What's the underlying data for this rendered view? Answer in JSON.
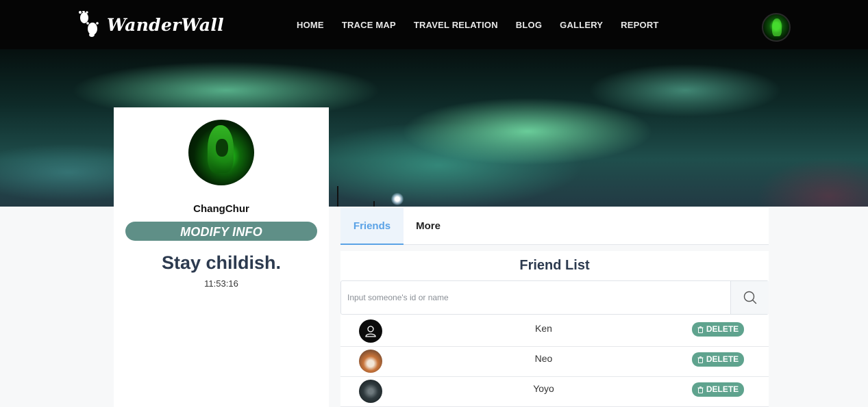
{
  "nav": {
    "brand": "WanderWall",
    "items": [
      "HOME",
      "TRACE MAP",
      "TRAVEL RELATION",
      "BLOG",
      "GALLERY",
      "REPORT"
    ]
  },
  "profile": {
    "username": "ChangChur",
    "modify_label": "MODIFY INFO",
    "motto": "Stay childish.",
    "clock": "11:53:16"
  },
  "tabs": [
    "Friends",
    "More"
  ],
  "friend_list": {
    "title": "Friend List",
    "search_placeholder": "Input someone's id or name",
    "delete_label": "DELETE",
    "friends": [
      {
        "name": "Ken",
        "avatar": "default-user-icon"
      },
      {
        "name": "Neo",
        "avatar": "fox-photo"
      },
      {
        "name": "Yoyo",
        "avatar": "dark-photo"
      }
    ]
  },
  "colors": {
    "nav_bg": "#050505",
    "modify_btn": "#5f8f87",
    "delete_btn": "#5fa38e",
    "active_tab": "#5aa2e6",
    "heading": "#2c3a4f"
  }
}
